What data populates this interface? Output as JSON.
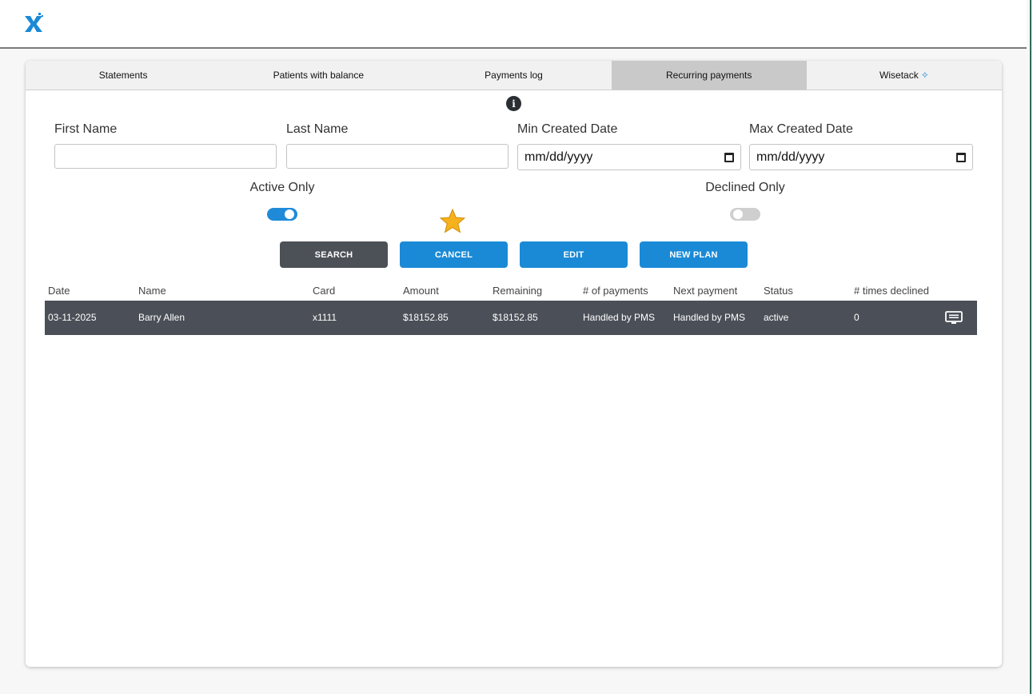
{
  "app": {
    "logo_icon": "x-logo-icon",
    "brand_color": "#1a8ad6"
  },
  "tabs": [
    {
      "label": "Statements",
      "active": false
    },
    {
      "label": "Patients with balance",
      "active": false
    },
    {
      "label": "Payments log",
      "active": false
    },
    {
      "label": "Recurring payments",
      "active": true
    },
    {
      "label": "Wisetack",
      "active": false,
      "icon": "sparkle-icon"
    }
  ],
  "filters": {
    "first_name": {
      "label": "First Name",
      "value": ""
    },
    "last_name": {
      "label": "Last Name",
      "value": ""
    },
    "min_created_date": {
      "label": "Min Created Date",
      "placeholder": "mm/dd/yyyy"
    },
    "max_created_date": {
      "label": "Max Created Date",
      "placeholder": "mm/dd/yyyy"
    },
    "active_only": {
      "label": "Active Only",
      "on": true
    },
    "declined_only": {
      "label": "Declined Only",
      "on": false
    }
  },
  "buttons": {
    "search": "SEARCH",
    "cancel": "CANCEL",
    "edit": "EDIT",
    "new_plan": "NEW PLAN"
  },
  "table": {
    "columns": [
      "Date",
      "Name",
      "Card",
      "Amount",
      "Remaining",
      "# of payments",
      "Next payment",
      "Status",
      "# times declined"
    ],
    "rows": [
      [
        "03-11-2025",
        "Barry Allen",
        "x1111",
        "$18152.85",
        "$18152.85",
        "Handled by PMS",
        "Handled by PMS",
        "active",
        "0"
      ]
    ],
    "row_action_icon": "message-icon"
  }
}
